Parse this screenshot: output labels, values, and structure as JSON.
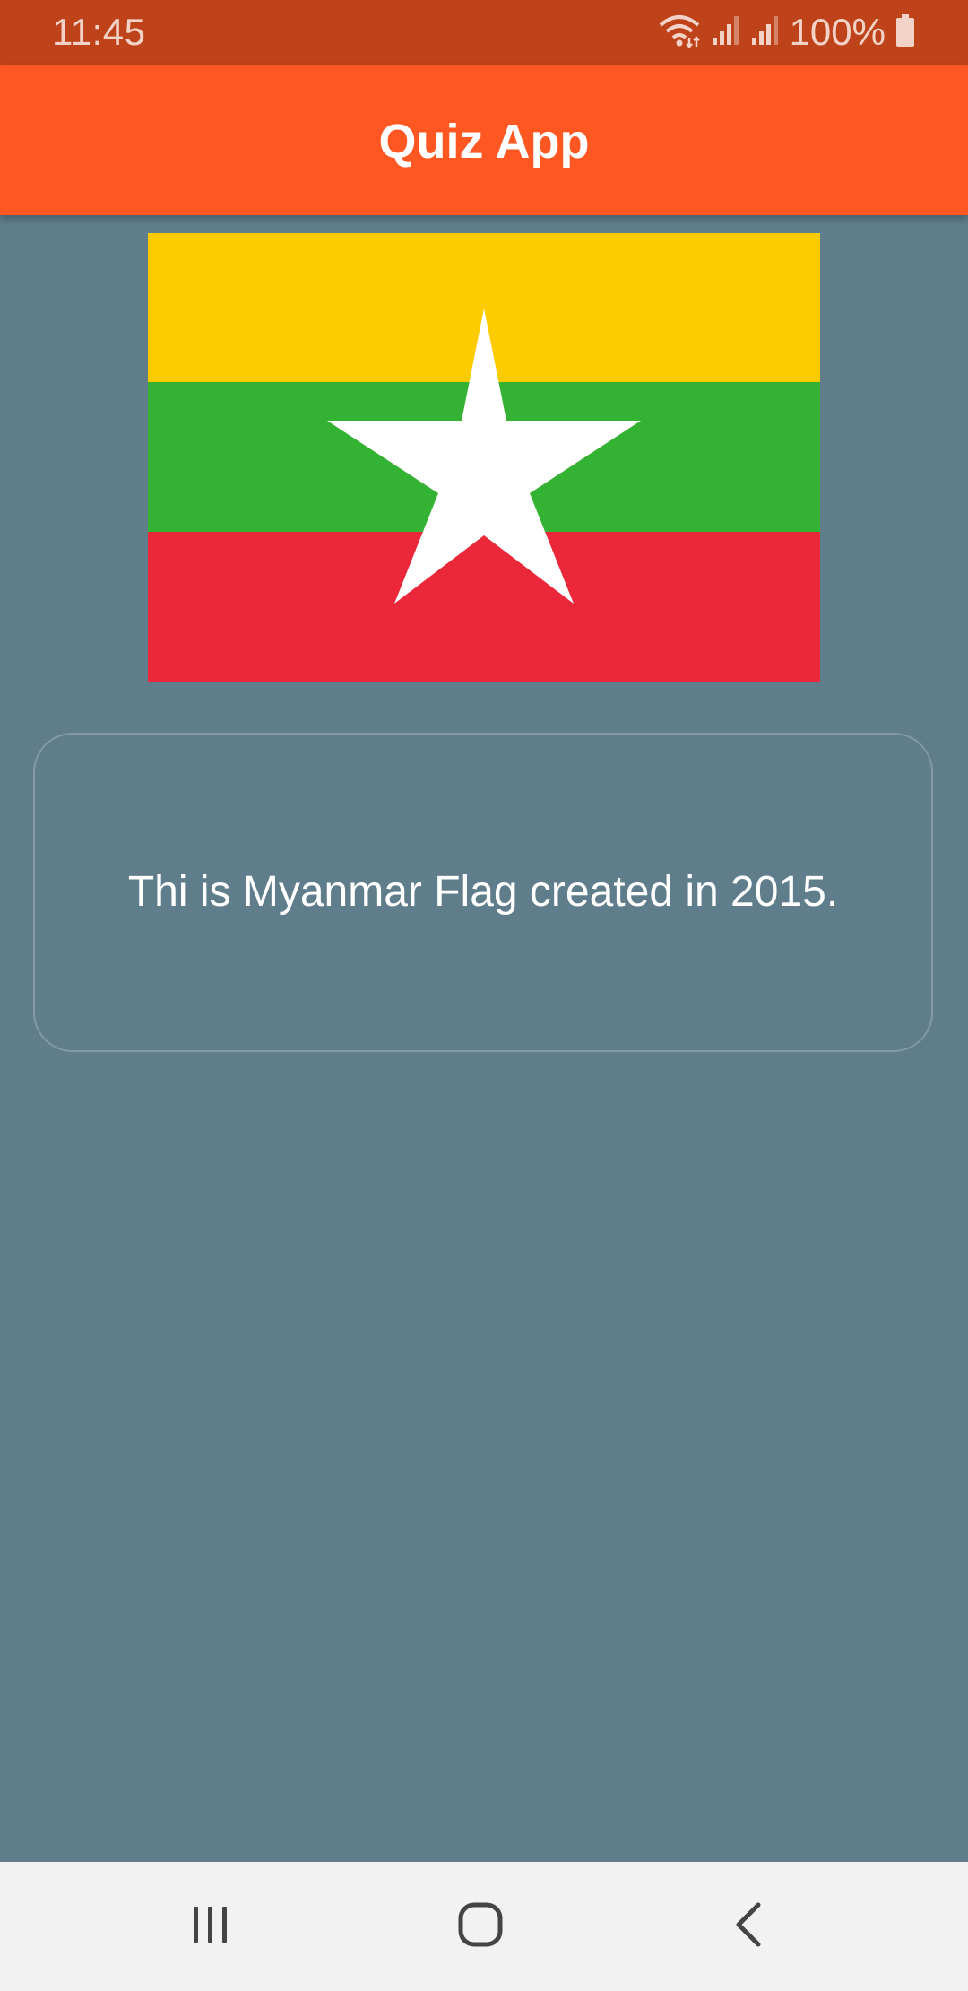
{
  "status_bar": {
    "time": "11:45",
    "battery": "100%",
    "icons": [
      "wifi-icon",
      "signal-icon",
      "signal-icon",
      "battery-icon"
    ]
  },
  "app_bar": {
    "title": "Quiz App"
  },
  "flag": {
    "icon": "myanmar-flag",
    "colors": {
      "yellow": "#fecb00",
      "green": "#34b233",
      "red": "#ea2839",
      "star": "#ffffff"
    }
  },
  "card": {
    "text": "Thi is Myanmar Flag created in 2015."
  },
  "nav_bar": {
    "items": [
      "recent-apps-icon",
      "home-icon",
      "back-icon"
    ]
  },
  "colors": {
    "background": "#607d8b",
    "app_bar": "#ff5722",
    "status_bar": "#bf431a"
  }
}
